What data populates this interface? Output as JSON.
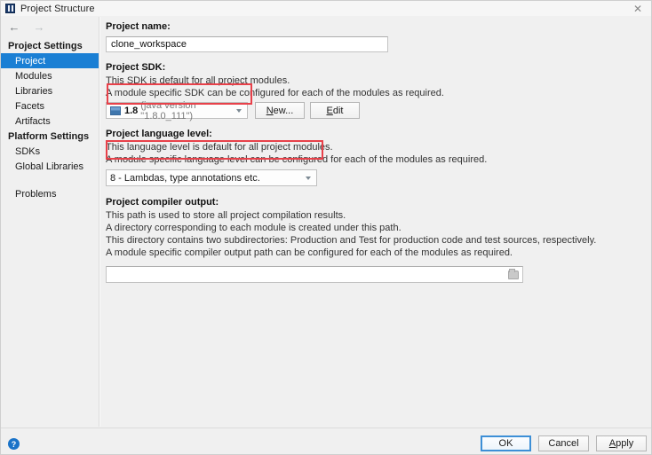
{
  "window": {
    "title": "Project Structure",
    "app_icon": "project-structure-icon",
    "close_icon": "✕"
  },
  "nav": {
    "back_icon": "←",
    "forward_icon": "→"
  },
  "sidebar": {
    "groups": [
      {
        "label": "Project Settings",
        "items": [
          {
            "label": "Project",
            "selected": true
          },
          {
            "label": "Modules",
            "selected": false
          },
          {
            "label": "Libraries",
            "selected": false
          },
          {
            "label": "Facets",
            "selected": false
          },
          {
            "label": "Artifacts",
            "selected": false
          }
        ]
      },
      {
        "label": "Platform Settings",
        "items": [
          {
            "label": "SDKs",
            "selected": false
          },
          {
            "label": "Global Libraries",
            "selected": false
          }
        ]
      }
    ],
    "problems_label": "Problems",
    "selected_color": "#1a7fd4"
  },
  "main": {
    "project_name": {
      "label": "Project name:",
      "value": "clone_workspace",
      "placeholder": ""
    },
    "project_sdk": {
      "label": "Project SDK:",
      "desc_line1": "This SDK is default for all project modules.",
      "desc_line2": "A module specific SDK can be configured for each of the modules as required.",
      "selected_version": "1.8",
      "selected_detail": "(java version \"1.8.0_111\")",
      "new_button": "New...",
      "new_button_mnemonic": "N",
      "edit_button": "Edit",
      "edit_button_mnemonic": "E",
      "highlighted": true
    },
    "language_level": {
      "label": "Project language level:",
      "desc_line1": "This language level is default for all project modules.",
      "desc_line2": "A module specific language level can be configured for each of the modules as required.",
      "selected": "8 - Lambdas, type annotations etc.",
      "highlighted": true
    },
    "compiler_output": {
      "label": "Project compiler output:",
      "desc_line1": "This path is used to store all project compilation results.",
      "desc_line2": "A directory corresponding to each module is created under this path.",
      "desc_line3": "This directory contains two subdirectories: Production and Test for production code and test sources, respectively.",
      "desc_line4": "A module specific compiler output path can be configured for each of the modules as required.",
      "value": "",
      "browse_icon": "folder-icon"
    }
  },
  "footer": {
    "help_icon": "?",
    "ok_label": "OK",
    "cancel_label": "Cancel",
    "apply_label": "Apply",
    "apply_mnemonic": "A"
  },
  "colors": {
    "accent": "#1a7fd4",
    "annotation_red": "#e8414a",
    "focus_blue": "#3d8fd6"
  }
}
